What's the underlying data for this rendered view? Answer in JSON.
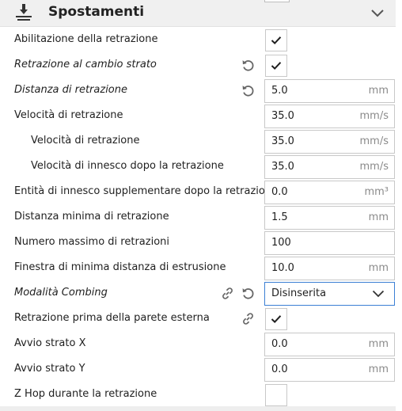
{
  "section": {
    "title": "Spostamenti",
    "icon": "travel-settings-icon",
    "collapse_icon": "chevron-down-icon"
  },
  "colors": {
    "header_bg": "#f0f0f0",
    "select_border": "#3b7fd4",
    "icon_gray": "#666666"
  },
  "settings": [
    {
      "label": "Abilitazione della retrazione",
      "type": "checkbox",
      "checked": true
    },
    {
      "label": "Retrazione al cambio strato",
      "type": "checkbox",
      "checked": true,
      "italic": true,
      "reset": true
    },
    {
      "label": "Distanza di retrazione",
      "type": "number",
      "value": "5.0",
      "unit": "mm",
      "italic": true,
      "reset": true
    },
    {
      "label": "Velocità di retrazione",
      "type": "number",
      "value": "35.0",
      "unit": "mm/s"
    },
    {
      "label": "Velocità di retrazione",
      "type": "number",
      "value": "35.0",
      "unit": "mm/s",
      "indent": true
    },
    {
      "label": "Velocità di innesco dopo la retrazione",
      "type": "number",
      "value": "35.0",
      "unit": "mm/s",
      "indent": true
    },
    {
      "label": "Entità di innesco supplementare dopo la retrazione",
      "type": "number",
      "value": "0.0",
      "unit": "mm³"
    },
    {
      "label": "Distanza minima di retrazione",
      "type": "number",
      "value": "1.5",
      "unit": "mm"
    },
    {
      "label": "Numero massimo di retrazioni",
      "type": "number",
      "value": "100",
      "unit": ""
    },
    {
      "label": "Finestra di minima distanza di estrusione",
      "type": "number",
      "value": "10.0",
      "unit": "mm"
    },
    {
      "label": "Modalità Combing",
      "type": "select",
      "value": "Disinserita",
      "italic": true,
      "link": true,
      "reset": true
    },
    {
      "label": "Retrazione prima della parete esterna",
      "type": "checkbox",
      "checked": true,
      "link": true
    },
    {
      "label": "Avvio strato X",
      "type": "number",
      "value": "0.0",
      "unit": "mm"
    },
    {
      "label": "Avvio strato Y",
      "type": "number",
      "value": "0.0",
      "unit": "mm"
    },
    {
      "label": "Z Hop durante la retrazione",
      "type": "checkbox",
      "checked": false
    }
  ]
}
